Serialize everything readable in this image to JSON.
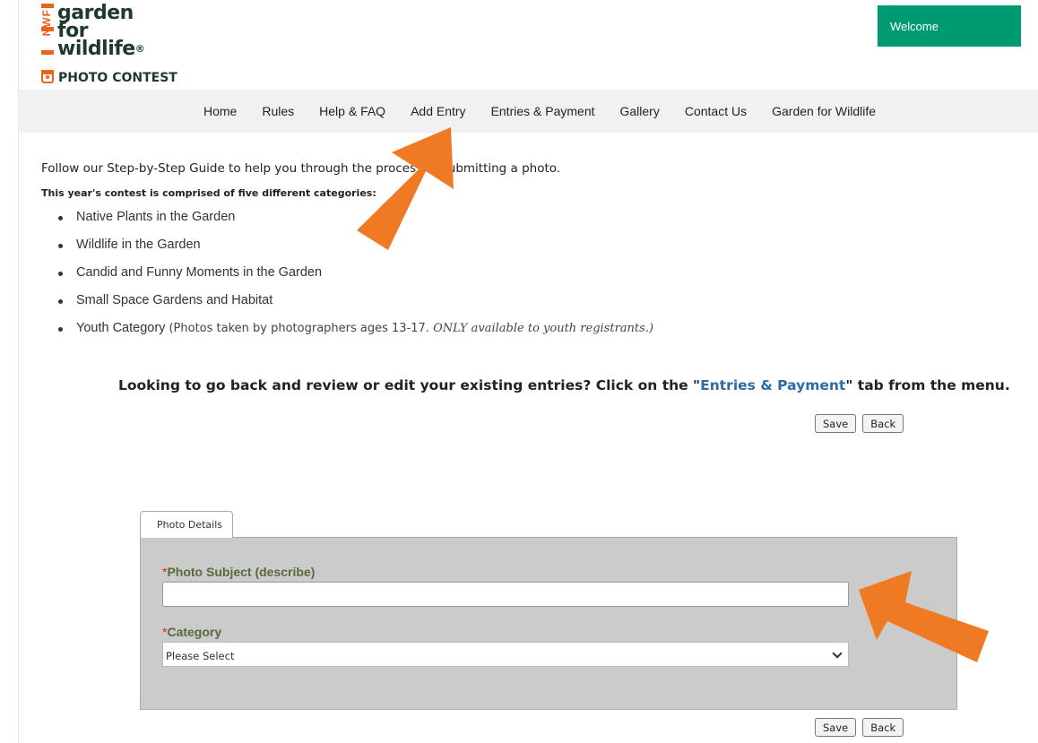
{
  "logo": {
    "mark": "NWF",
    "line1": "garden",
    "line2": "for",
    "line3": "wildlife",
    "reg": "®",
    "contest": "PHOTO CONTEST"
  },
  "welcome": "Welcome",
  "nav": [
    "Home",
    "Rules",
    "Help & FAQ",
    "Add Entry",
    "Entries & Payment",
    "Gallery",
    "Contact Us",
    "Garden for Wildlife"
  ],
  "intro": "Follow our Step-by-Step Guide to help you through the process of submitting a photo.",
  "categories_title": "This year's contest is comprised of five different categories:",
  "categories": [
    "Native Plants in the Garden",
    "Wildlife in the Garden",
    "Candid and Funny Moments in the Garden",
    "Small Space Gardens and Habitat",
    "Youth Category"
  ],
  "youth_note_pre": "(Photos taken by photographers ages 13-17. ",
  "youth_note_em": "ONLY available to youth registrants.)",
  "review": {
    "pre": "Looking to go back and review or edit your existing entries? Click on the \"",
    "link": "Entries & Payment",
    "post": "\" tab from the menu."
  },
  "buttons": {
    "save": "Save",
    "back": "Back"
  },
  "form": {
    "tab": "Photo Details",
    "required_mark": "*",
    "subject_label": "Photo Subject (describe)",
    "subject_value": "",
    "category_label": "Category",
    "category_selected": "Please Select"
  },
  "colors": {
    "accent_green": "#009a72",
    "arrow_orange": "#ef7a23",
    "label_green": "#556b3a",
    "link_blue": "#2e6ba4"
  }
}
